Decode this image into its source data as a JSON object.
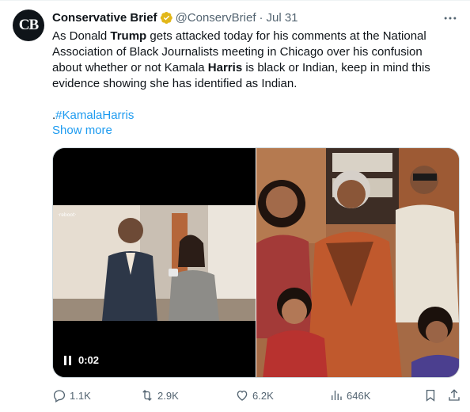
{
  "author": {
    "avatar_text": "CB",
    "name": "Conservative Brief",
    "handle": "@ConservBrief",
    "separator": "·",
    "date": "Jul 31",
    "verified_icon": "gold-verified-badge-icon"
  },
  "tweet": {
    "text_part1": "As Donald ",
    "bold1": "Trump",
    "text_part2": " gets attacked today for his comments at the National Association of Black Journalists meeting in Chicago over his confusion about whether or not Kamala ",
    "bold2": "Harris",
    "text_part3": " is black or Indian, keep in mind this evidence showing she has identified as Indian.",
    "hashtag_prefix": ".",
    "hashtag": "#KamalaHarris",
    "show_more": "Show more"
  },
  "media": {
    "video_time": "0:02",
    "video_icon": "pause-icon",
    "photo_icon": "family-photo"
  },
  "actions": {
    "reply_count": "1.1K",
    "retweet_count": "2.9K",
    "like_count": "6.2K",
    "views_count": "646K"
  },
  "colors": {
    "accent": "#1d9bf0",
    "secondary_text": "#536471",
    "verified_gold": "#e2b719"
  }
}
